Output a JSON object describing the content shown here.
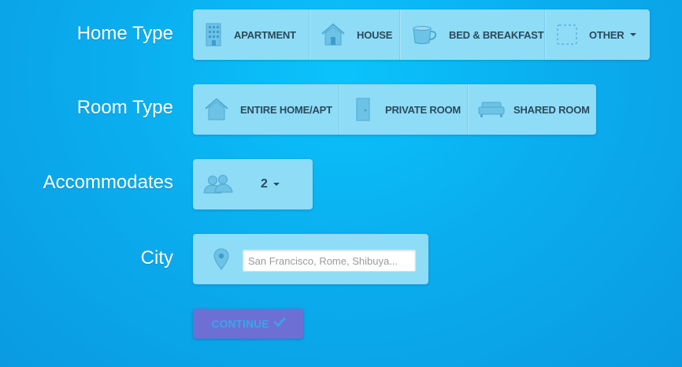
{
  "home_type": {
    "label": "Home Type",
    "options": [
      {
        "label": "APARTMENT",
        "icon": "apartment-building-icon"
      },
      {
        "label": "HOUSE",
        "icon": "house-icon"
      },
      {
        "label": "BED & BREAKFAST",
        "icon": "coffee-cup-icon"
      },
      {
        "label": "OTHER",
        "icon": "dashed-square-icon"
      }
    ]
  },
  "room_type": {
    "label": "Room Type",
    "options": [
      {
        "label": "ENTIRE HOME/APT",
        "icon": "house-icon"
      },
      {
        "label": "PRIVATE ROOM",
        "icon": "door-icon"
      },
      {
        "label": "SHARED ROOM",
        "icon": "couch-icon"
      }
    ]
  },
  "accommodates": {
    "label": "Accommodates",
    "value": "2",
    "icon": "people-icon"
  },
  "city": {
    "label": "City",
    "placeholder": "San Francisco, Rome, Shibuya...",
    "icon": "map-pin-icon"
  },
  "continue_button": {
    "label": "CONTINUE",
    "icon": "checkmark-icon"
  },
  "colors": {
    "background": "#0aaeee",
    "panel": "#8fdcf7",
    "icon": "#5fb8dd",
    "button": "#6d6fd4",
    "button_text": "#3aa4ea"
  }
}
